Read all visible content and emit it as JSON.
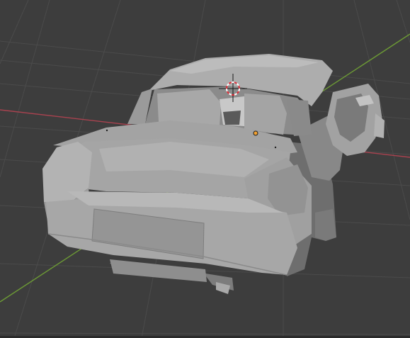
{
  "app": {
    "editor": "3D Viewport",
    "shading_mode": "solid"
  },
  "colors": {
    "viewport_bg": "#3d3d3d",
    "grid_line": "#4a4a4a",
    "x_axis": "#a8424f",
    "y_axis": "#6c9a35",
    "mesh_base": "#9c9c9c",
    "mesh_light": "#bdbdbd",
    "mesh_dark": "#6f6f6f",
    "cursor_red": "#e0303a",
    "origin_dot": "#f2a030"
  },
  "icons": {
    "cursor": "3d-cursor-icon",
    "origin": "object-origin-icon"
  },
  "scene": {
    "object": "car-mesh",
    "selected": false
  }
}
